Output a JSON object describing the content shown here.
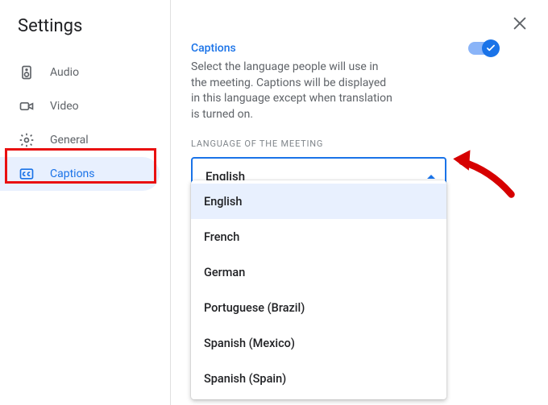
{
  "title": "Settings",
  "nav": {
    "audio": "Audio",
    "video": "Video",
    "general": "General",
    "captions": "Captions"
  },
  "section": {
    "title": "Captions",
    "description": "Select the language people will use in the meeting. Captions will be displayed in this language except when translation is turned on.",
    "field_label": "LANGUAGE OF THE MEETING",
    "selected": "English"
  },
  "options": [
    "English",
    "French",
    "German",
    "Portuguese (Brazil)",
    "Spanish (Mexico)",
    "Spanish (Spain)"
  ]
}
